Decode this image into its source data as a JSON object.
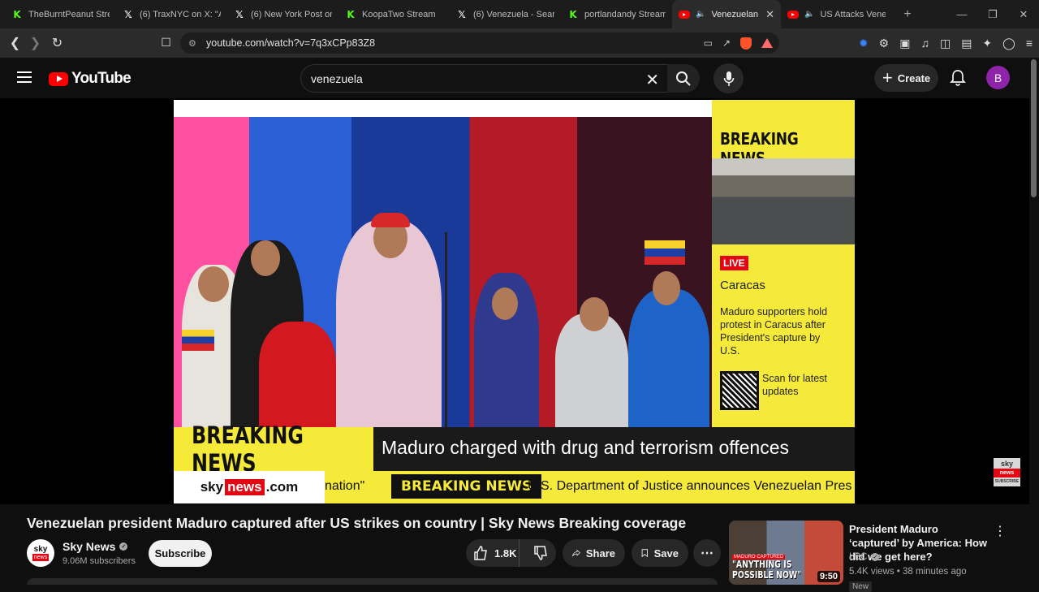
{
  "browser": {
    "tabs": [
      {
        "label": "TheBurntPeanut Strea",
        "favicon": "kick-icon"
      },
      {
        "label": "(6) TraxNYC on X: \"An",
        "favicon": "x-icon"
      },
      {
        "label": "(6) New York Post on",
        "favicon": "x-icon"
      },
      {
        "label": "KoopaTwo Stream",
        "favicon": "kick-icon"
      },
      {
        "label": "(6) Venezuela - Searc",
        "favicon": "x-icon"
      },
      {
        "label": "portlandandy Stream",
        "favicon": "kick-icon"
      },
      {
        "label": "Venezuelan pr",
        "favicon": "youtube-icon",
        "active": true
      },
      {
        "label": "US Attacks Venez",
        "favicon": "youtube-icon"
      }
    ],
    "url": "youtube.com/watch?v=7q3xCPp83Z8"
  },
  "youtube": {
    "logo_text": "YouTube",
    "search_value": "venezuela",
    "create_label": "Create",
    "avatar_letter": "B"
  },
  "video": {
    "side_breaking": "BREAKING NEWS",
    "live": "LIVE",
    "city": "Caracas",
    "side_desc": "Maduro supporters hold protest in Caracus after President's capture  by U.S.",
    "scan": "Scan for latest updates",
    "lower_tag": "BREAKING NEWS",
    "lower_headline": "Maduro charged with drug and terrorism offences",
    "ticker_brand_a": "sky",
    "ticker_brand_b": "news",
    "ticker_brand_c": ".com",
    "ticker_quote": "nation\"",
    "ticker_tag": "BREAKING NEWS",
    "ticker_story": "U.S. Department of Justice announces Venezuelan Pres",
    "watermark_a": "sky",
    "watermark_b": "news",
    "watermark_c": "SUBSCRIBE"
  },
  "meta": {
    "title": "Venezuelan president Maduro captured after US strikes on country | Sky News Breaking coverage",
    "channel": "Sky News",
    "channel_avatar_a": "sky",
    "channel_avatar_b": "news",
    "subscribers": "9.06M subscribers",
    "subscribe_label": "Subscribe",
    "likes": "1.8K",
    "share_label": "Share",
    "save_label": "Save"
  },
  "recommended": {
    "title": "President Maduro ‘captured’ by America: How did we get here?",
    "channel": "LBC",
    "meta": "5.4K views • 38 minutes ago",
    "badge": "New",
    "duration": "9:50",
    "thumb_tag": "MADURO CAPTURED",
    "thumb_caption": "\"ANYTHING IS POSSIBLE NOW\""
  },
  "colors": {
    "accent_red": "#ff0000",
    "sky_yellow": "#f5e93a",
    "live_red": "#e30613",
    "kick_green": "#53fc18"
  }
}
